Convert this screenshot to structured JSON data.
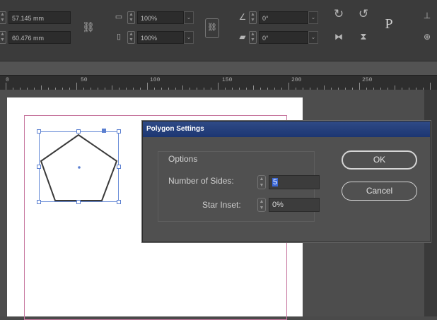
{
  "control_bar": {
    "w_field": "57.145 mm",
    "h_field": "60.476 mm",
    "scale_x": "100%",
    "scale_y": "100%",
    "rotate": "0°",
    "shear": "0°",
    "ref_point_glyph": "P"
  },
  "ruler": {
    "ticks": [
      "0",
      "50",
      "100",
      "150",
      "200",
      "250"
    ]
  },
  "dialog": {
    "title": "Polygon Settings",
    "group_label": "Options",
    "sides_label": "Number of Sides:",
    "sides_value": "5",
    "star_inset_label": "Star Inset:",
    "star_inset_value": "0%",
    "ok_label": "OK",
    "cancel_label": "Cancel"
  },
  "colors": {
    "title_bar": "#1c3672",
    "selection": "#6b8ed8",
    "margin_guide": "#c878a0"
  }
}
